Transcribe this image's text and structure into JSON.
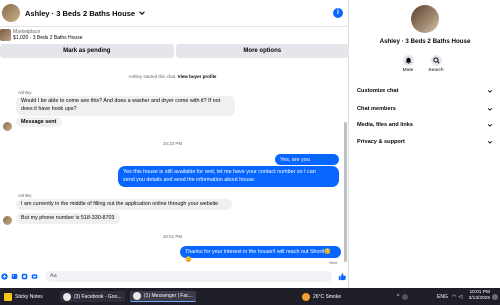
{
  "chat": {
    "title": "Ashley · 3 Beds 2 Baths House",
    "listing_label": "Marketplace",
    "listing_price": "$1,020 · 3 Beds 2 Baths House",
    "mark_pending_label": "Mark as pending",
    "more_options_label": "More options",
    "started_text": "Ashley started this chat.",
    "view_profile_label": "View buyer profile",
    "composer_placeholder": "Aa",
    "messages": [
      {
        "sender": "Ashley",
        "text_1": "Would I be able to come see this? And does a washer and dryer come with it? If not",
        "text_2": "does it have hook ups?"
      },
      {
        "text": "Message sent"
      },
      {
        "time": "10:23 PM"
      },
      {
        "text": "Yes, are you interested?"
      },
      {
        "text_1": "Yes this house is still available for rent, let me have your contact number so I can",
        "text_2": "send you details and send the information about house."
      },
      {
        "sender": "Ashley",
        "text": "I am currently in the middle of filling out the application online through your website"
      },
      {
        "text": "But my phone number is 518-330-8703"
      },
      {
        "time": "10:01 PM"
      },
      {
        "text": "Thanks for your interest in the house!I will reach out Shortl😊 😊"
      },
      {
        "status": "Sent"
      }
    ]
  },
  "sidebar": {
    "name": "Ashley · 3 Beds 2 Baths House",
    "mute_label": "Mute",
    "search_label": "Search",
    "sections": [
      "Customize chat",
      "Chat members",
      "Media, files and links",
      "Privacy & support"
    ]
  },
  "taskbar": {
    "sticky_notes": "Sticky Notes",
    "facebook_tab": "(3) Facebook - Goo...",
    "messenger_tab": "(1) Messenger | Fac...",
    "weather": "26°C  Smoke",
    "language": "ENG",
    "time": "10:01 PM",
    "date": "3/13/2025"
  },
  "colors": {
    "accent": "#0866ff",
    "bubble_in": "#f0f0f0",
    "taskbar": "#1f1f2a"
  }
}
